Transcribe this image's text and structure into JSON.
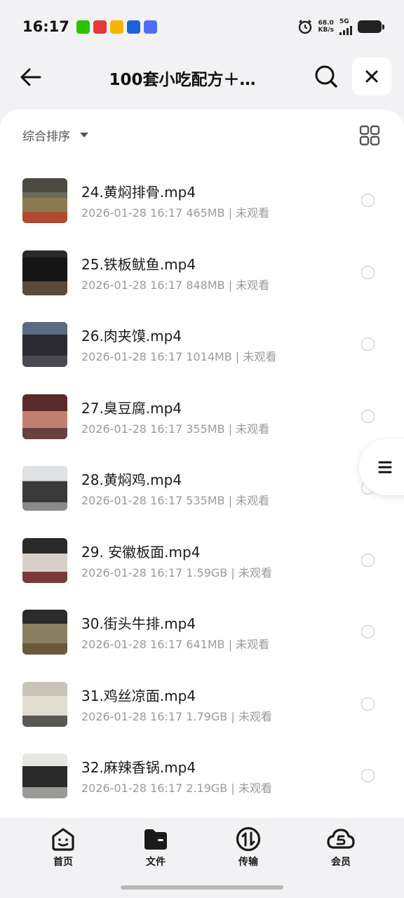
{
  "status_bar": {
    "time": "16:17",
    "net_speed_value": "68.0",
    "net_speed_unit": "KB/s",
    "network_type": "5G",
    "notification_icons": [
      "wechat-icon",
      "toutiao-icon",
      "mail-icon",
      "app-icon",
      "vivo-icon"
    ],
    "alarm_icon": "alarm-icon"
  },
  "header": {
    "title": "100套小吃配方＋…",
    "back_icon": "back-arrow-icon",
    "search_icon": "search-icon",
    "close_icon": "close-icon"
  },
  "toolbar": {
    "sort_label": "综合排序",
    "view_toggle_icon": "grid-view-icon"
  },
  "files": [
    {
      "name": "24.黄焖排骨.mp4",
      "date": "2026-01-28 16:17",
      "size": "465MB",
      "status": "未观看"
    },
    {
      "name": "25.铁板鱿鱼.mp4",
      "date": "2026-01-28 16:17",
      "size": "848MB",
      "status": "未观看"
    },
    {
      "name": "26.肉夹馍.mp4",
      "date": "2026-01-28 16:17",
      "size": "1014MB",
      "status": "未观看"
    },
    {
      "name": "27.臭豆腐.mp4",
      "date": "2026-01-28 16:17",
      "size": "355MB",
      "status": "未观看"
    },
    {
      "name": "28.黄焖鸡.mp4",
      "date": "2026-01-28 16:17",
      "size": "535MB",
      "status": "未观看"
    },
    {
      "name": "29. 安徽板面.mp4",
      "date": "2026-01-28 16:17",
      "size": "1.59GB",
      "status": "未观看"
    },
    {
      "name": "30.街头牛排.mp4",
      "date": "2026-01-28 16:17",
      "size": "641MB",
      "status": "未观看"
    },
    {
      "name": "31.鸡丝凉面.mp4",
      "date": "2026-01-28 16:17",
      "size": "1.79GB",
      "status": "未观看"
    },
    {
      "name": "32.麻辣香锅.mp4",
      "date": "2026-01-28 16:17",
      "size": "2.19GB",
      "status": "未观看"
    }
  ],
  "side_menu_icon": "menu-icon",
  "bottom_nav": [
    {
      "label": "首页",
      "icon": "home-face-icon"
    },
    {
      "label": "文件",
      "icon": "folder-icon"
    },
    {
      "label": "传输",
      "icon": "transfer-icon"
    },
    {
      "label": "会员",
      "icon": "cloud-vip-icon"
    }
  ],
  "colors": {
    "background": "#f2f2f4",
    "sheet": "#ffffff",
    "text_primary": "#1a1a1a",
    "text_secondary": "#9a9a9a"
  }
}
